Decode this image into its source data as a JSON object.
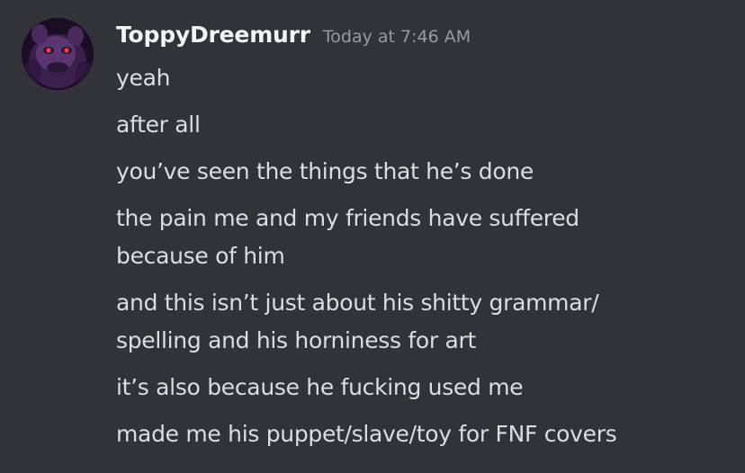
{
  "message": {
    "author": {
      "username": "ToppyDreemurr",
      "avatar_icon": "user-avatar"
    },
    "timestamp": "Today at 7:46 AM",
    "lines": [
      "yeah",
      "after all",
      "you’ve seen the things that he’s done",
      [
        "the pain me and my friends have suffered",
        "because of him"
      ],
      [
        "and this isn’t just about his shitty grammar/",
        "spelling and his horniness for art"
      ],
      "it’s also because he fucking used me",
      "made me his puppet/slave/toy for FNF covers"
    ]
  },
  "colors": {
    "background": "#313338",
    "username": "#f2f3f5",
    "timestamp": "#949ba4",
    "message_text": "#dbdee1"
  }
}
